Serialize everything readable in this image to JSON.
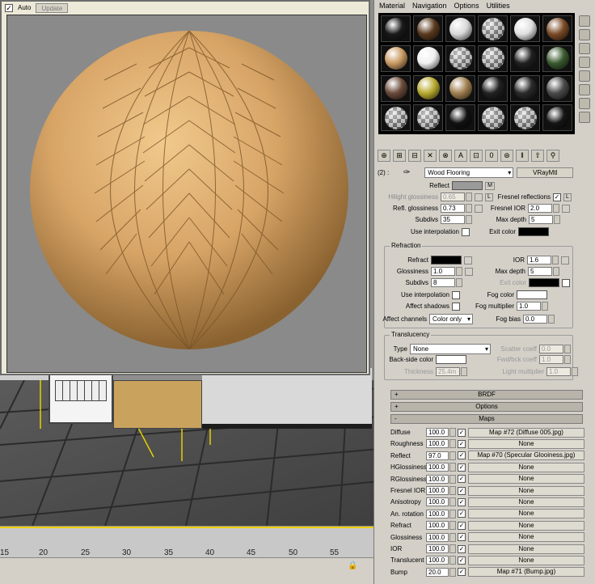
{
  "preview": {
    "auto_label": "Auto",
    "auto_checked": "✓",
    "update_label": "Update"
  },
  "menu": [
    "Material",
    "Navigation",
    "Options",
    "Utilities"
  ],
  "slots": [
    "#1a1a1a",
    "#5a3a1e",
    "#d8d8d8",
    "checker",
    "#e0e0e0",
    "#7a4a26",
    "#c99a62",
    "#f0f0f0",
    "checker",
    "checker",
    "#202020",
    "#3a5a30",
    "#6a4a3a",
    "#b8aa30",
    "#a08050",
    "#222",
    "#2a2a2a",
    "#4a4a4a",
    "checker",
    "checker",
    "#111",
    "checker",
    "checker",
    "#151515"
  ],
  "toolbar": [
    "⊕",
    "⊞",
    "⊟",
    "✕",
    "⊗",
    "A",
    "⊡",
    "0",
    "⊛",
    "‖",
    "⇧",
    "⚲"
  ],
  "namerow": {
    "index": "(2) :",
    "name": "Wood Flooring",
    "type": "VRayMtl"
  },
  "reflect": {
    "reflect_label": "Reflect",
    "m_label": "M",
    "hilight_label": "Hilight glossiness",
    "hilight_value": "0.65",
    "l_label": "L",
    "fresnel_label": "Fresnel reflections",
    "fresnel_l": "L",
    "refl_gloss_label": "Refl. glossiness",
    "refl_gloss_value": "0.73",
    "fresnel_ior_label": "Fresnel IOR",
    "fresnel_ior_value": "2.0",
    "subdivs_label": "Subdivs",
    "subdivs_value": "35",
    "maxdepth_label": "Max depth",
    "maxdepth_value": "5",
    "useinterp_label": "Use interpolation",
    "exitcolor_label": "Exit color"
  },
  "refraction": {
    "title": "Refraction",
    "refract_label": "Refract",
    "ior_label": "IOR",
    "ior_value": "1.6",
    "gloss_label": "Glossiness",
    "gloss_value": "1.0",
    "maxdepth_label": "Max depth",
    "maxdepth_value": "5",
    "subdivs_label": "Subdivs",
    "subdivs_value": "8",
    "exitcolor_label": "Exit color",
    "useinterp_label": "Use interpolation",
    "fogcolor_label": "Fog color",
    "affectshadows_label": "Affect shadows",
    "fogmult_label": "Fog multiplier",
    "fogmult_value": "1.0",
    "affectchannels_label": "Affect channels",
    "affectchannels_value": "Color only",
    "fogbias_label": "Fog bias",
    "fogbias_value": "0.0"
  },
  "translucency": {
    "title": "Translucency",
    "type_label": "Type",
    "type_value": "None",
    "scatter_label": "Scatter coeff",
    "scatter_value": "0.0",
    "backside_label": "Back-side color",
    "fwdbck_label": "Fwd/bck coeff",
    "fwdbck_value": "1.0",
    "thickness_label": "Thickness",
    "thickness_value": "25.4m",
    "lightmult_label": "Light multiplier",
    "lightmult_value": "1.0"
  },
  "rollouts": [
    {
      "sign": "+",
      "label": "BRDF"
    },
    {
      "sign": "+",
      "label": "Options"
    },
    {
      "sign": "-",
      "label": "Maps"
    }
  ],
  "maps": [
    {
      "name": "Diffuse",
      "amount": "100.0",
      "map": "Map #72 (Diffuse 005.jpg)"
    },
    {
      "name": "Roughness",
      "amount": "100.0",
      "map": "None"
    },
    {
      "name": "Reflect",
      "amount": "97.0",
      "map": "Map #70 (Specular Glooiness.jpg)"
    },
    {
      "name": "HGlossiness",
      "amount": "100.0",
      "map": "None"
    },
    {
      "name": "RGlossiness",
      "amount": "100.0",
      "map": "None"
    },
    {
      "name": "Fresnel IOR",
      "amount": "100.0",
      "map": "None"
    },
    {
      "name": "Anisotropy",
      "amount": "100.0",
      "map": "None"
    },
    {
      "name": "An. rotation",
      "amount": "100.0",
      "map": "None"
    },
    {
      "name": "Refract",
      "amount": "100.0",
      "map": "None"
    },
    {
      "name": "Glossiness",
      "amount": "100.0",
      "map": "None"
    },
    {
      "name": "IOR",
      "amount": "100.0",
      "map": "None"
    },
    {
      "name": "Translucent",
      "amount": "100.0",
      "map": "None"
    },
    {
      "name": "Bump",
      "amount": "20.0",
      "map": "Map #71 (Bump.jpg)"
    }
  ],
  "map_check": "✓",
  "ruler": [
    "15",
    "20",
    "25",
    "30",
    "35",
    "40",
    "45",
    "50",
    "55"
  ],
  "colors": {
    "reflect_swatch": "#9a9a9a",
    "exit_color": "#000000",
    "refract_swatch": "#000000",
    "fog_color": "#ffffff",
    "backside_color": "#ffffff",
    "wood": "#d7a466"
  }
}
